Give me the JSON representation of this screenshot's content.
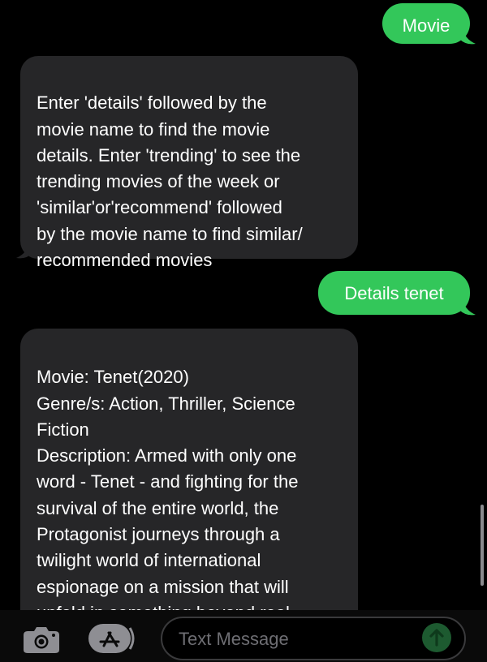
{
  "messages": [
    {
      "direction": "sent",
      "text": "Movie"
    },
    {
      "direction": "received",
      "text": "Enter 'details' followed by the\nmovie name to find the movie\ndetails. Enter 'trending' to see the\ntrending movies of the week or\n'similar'or'recommend' followed\nby the movie name to find similar/\nrecommended movies"
    },
    {
      "direction": "sent",
      "text": "Details tenet"
    },
    {
      "direction": "received",
      "text": "Movie: Tenet(2020)\nGenre/s: Action, Thriller, Science\nFiction\nDescription: Armed with only one\nword - Tenet - and fighting for the\nsurvival of the entire world, the\nProtagonist journeys through a\ntwilight world of international\nespionage on a mission that will\nunfold in something beyond real\ntime."
    }
  ],
  "composer": {
    "placeholder": "Text Message",
    "camera_icon": "camera-icon",
    "apps_icon": "app-store-icon",
    "send_icon": "send-arrow-up-icon"
  },
  "colors": {
    "sent_bubble": "#33c75a",
    "received_bubble": "#262628",
    "background": "#000000",
    "send_button_disabled": "#1d5a30"
  }
}
